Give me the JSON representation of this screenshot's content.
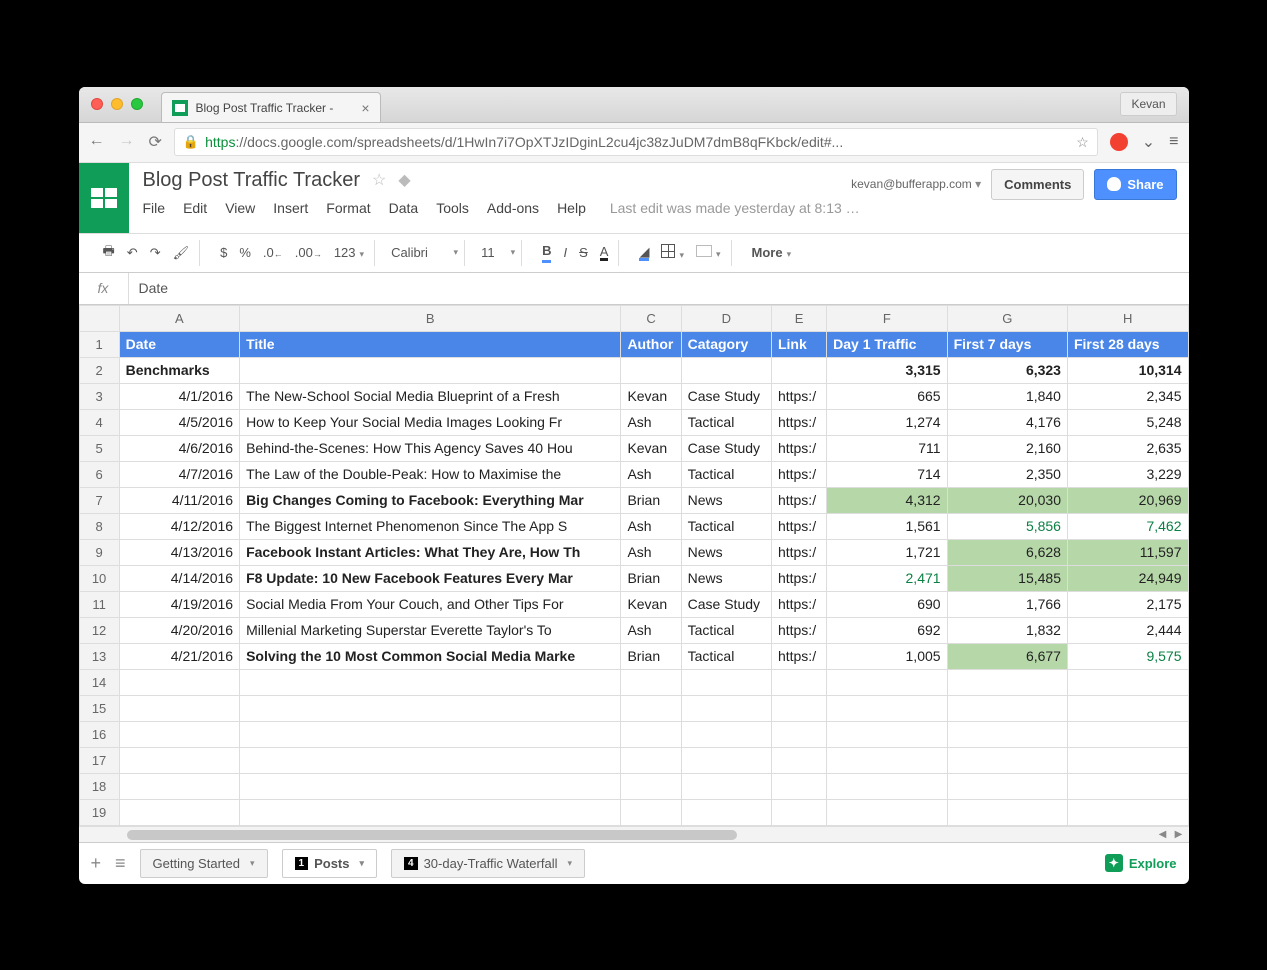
{
  "browser": {
    "tab_title": "Blog Post Traffic Tracker - ",
    "profile": "Kevan",
    "url_https": "https",
    "url_rest": "://docs.google.com/spreadsheets/d/1HwIn7i7OpXTJzIDginL2cu4jc38zJuDM7dmB8qFKbck/edit#..."
  },
  "doc": {
    "title": "Blog Post Traffic Tracker",
    "account": "kevan@bufferapp.com",
    "comments_btn": "Comments",
    "share_btn": "Share",
    "menus": [
      "File",
      "Edit",
      "View",
      "Insert",
      "Format",
      "Data",
      "Tools",
      "Add-ons",
      "Help"
    ],
    "status": "Last edit was made yesterday at 8:13 …"
  },
  "toolbar": {
    "currency": "$",
    "percent": "%",
    "dec_dec": ".0",
    "dec_inc": ".00",
    "numfmt": "123",
    "font": "Calibri",
    "size": "11",
    "more": "More"
  },
  "fx": {
    "value": "Date"
  },
  "columns": [
    "A",
    "B",
    "C",
    "D",
    "E",
    "F",
    "G",
    "H"
  ],
  "headers": {
    "A": "Date",
    "B": "Title",
    "C": "Author",
    "D": "Catagory",
    "E": "Link",
    "F": "Day 1 Traffic",
    "G": "First 7 days",
    "H": "First 28 days"
  },
  "rows": [
    {
      "n": 1,
      "type": "header"
    },
    {
      "n": 2,
      "type": "bench",
      "A": "Benchmarks",
      "F": "3,315",
      "G": "6,323",
      "H": "10,314"
    },
    {
      "n": 3,
      "A": "4/1/2016",
      "B": "The New-School Social Media Blueprint of a Fresh",
      "C": "Kevan",
      "D": "Case Study",
      "E": "https:/",
      "F": "665",
      "G": "1,840",
      "H": "2,345"
    },
    {
      "n": 4,
      "A": "4/5/2016",
      "B": "How to Keep Your Social Media Images Looking Fr",
      "C": "Ash",
      "D": "Tactical",
      "E": "https:/",
      "F": "1,274",
      "G": "4,176",
      "H": "5,248"
    },
    {
      "n": 5,
      "A": "4/6/2016",
      "B": "Behind-the-Scenes: How This Agency Saves 40 Hou",
      "C": "Kevan",
      "D": "Case Study",
      "E": "https:/",
      "F": "711",
      "G": "2,160",
      "H": "2,635"
    },
    {
      "n": 6,
      "A": "4/7/2016",
      "B": "The Law of the Double-Peak: How to Maximise the",
      "C": "Ash",
      "D": "Tactical",
      "E": "https:/",
      "F": "714",
      "G": "2,350",
      "H": "3,229"
    },
    {
      "n": 7,
      "A": "4/11/2016",
      "B": "Big Changes Coming to Facebook: Everything Mar",
      "Bb": true,
      "C": "Brian",
      "D": "News",
      "E": "https:/",
      "F": "4,312",
      "Fhl": true,
      "G": "20,030",
      "Ghl": true,
      "H": "20,969",
      "Hhl": true
    },
    {
      "n": 8,
      "A": "4/12/2016",
      "B": "The Biggest Internet Phenomenon Since The App S",
      "C": "Ash",
      "D": "Tactical",
      "E": "https:/",
      "F": "1,561",
      "G": "5,856",
      "Gg": true,
      "H": "7,462",
      "Hg": true
    },
    {
      "n": 9,
      "A": "4/13/2016",
      "B": "Facebook Instant Articles: What They Are, How Th",
      "Bb": true,
      "C": "Ash",
      "D": "News",
      "E": "https:/",
      "F": "1,721",
      "G": "6,628",
      "Ghl": true,
      "H": "11,597",
      "Hhl": true
    },
    {
      "n": 10,
      "A": "4/14/2016",
      "B": "F8 Update: 10 New Facebook Features Every Mar",
      "Bb": true,
      "C": "Brian",
      "D": "News",
      "E": "https:/",
      "F": "2,471",
      "Fg": true,
      "G": "15,485",
      "Ghl": true,
      "H": "24,949",
      "Hhl": true
    },
    {
      "n": 11,
      "A": "4/19/2016",
      "B": "Social Media From Your Couch, and Other Tips For",
      "C": "Kevan",
      "D": "Case Study",
      "E": "https:/",
      "F": "690",
      "G": "1,766",
      "H": "2,175"
    },
    {
      "n": 12,
      "A": "4/20/2016",
      "B": "Millenial Marketing Superstar Everette Taylor's To",
      "C": "Ash",
      "D": "Tactical",
      "E": "https:/",
      "F": "692",
      "G": "1,832",
      "H": "2,444"
    },
    {
      "n": 13,
      "A": "4/21/2016",
      "B": "Solving the 10 Most Common Social Media Marke",
      "Bb": true,
      "C": "Brian",
      "D": "Tactical",
      "E": "https:/",
      "F": "1,005",
      "G": "6,677",
      "Ghl": true,
      "H": "9,575",
      "Hg": true
    },
    {
      "n": 14
    },
    {
      "n": 15
    },
    {
      "n": 16
    },
    {
      "n": 17
    },
    {
      "n": 18
    },
    {
      "n": 19
    }
  ],
  "tabs": {
    "t1": "Getting Started",
    "t2": "Posts",
    "t2badge": "1",
    "t3": "30-day-Traffic Waterfall",
    "t3badge": "4"
  },
  "explore": "Explore"
}
